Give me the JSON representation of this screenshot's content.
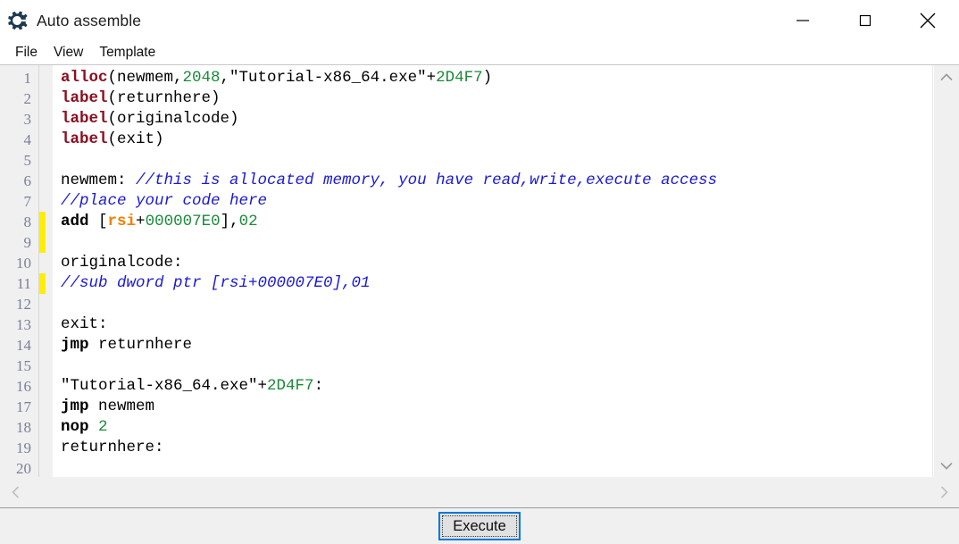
{
  "window": {
    "title": "Auto assemble",
    "icon": "cheat-engine-gear-icon",
    "controls": {
      "minimize": "minimize-icon",
      "maximize": "maximize-icon",
      "close": "close-icon"
    }
  },
  "menubar": {
    "items": [
      {
        "label": "File"
      },
      {
        "label": "View"
      },
      {
        "label": "Template"
      }
    ]
  },
  "editor": {
    "line_numbers": [
      "1",
      "2",
      "3",
      "4",
      "5",
      "6",
      "7",
      "8",
      "9",
      "10",
      "11",
      "12",
      "13",
      "14",
      "15",
      "16",
      "17",
      "18",
      "19",
      "20"
    ],
    "modified_markers": [
      8,
      9,
      11
    ],
    "lines": [
      {
        "n": "1",
        "tokens": [
          {
            "t": "alloc",
            "c": "tok-key"
          },
          {
            "t": "(newmem,",
            "c": "tok-plain"
          },
          {
            "t": "2048",
            "c": "tok-num"
          },
          {
            "t": ",\"Tutorial-x86_64.exe\"+",
            "c": "tok-str"
          },
          {
            "t": "2D4F7",
            "c": "tok-hex"
          },
          {
            "t": ")",
            "c": "tok-plain"
          }
        ]
      },
      {
        "n": "2",
        "tokens": [
          {
            "t": "label",
            "c": "tok-key"
          },
          {
            "t": "(returnhere)",
            "c": "tok-plain"
          }
        ]
      },
      {
        "n": "3",
        "tokens": [
          {
            "t": "label",
            "c": "tok-key"
          },
          {
            "t": "(originalcode)",
            "c": "tok-plain"
          }
        ]
      },
      {
        "n": "4",
        "tokens": [
          {
            "t": "label",
            "c": "tok-key"
          },
          {
            "t": "(exit)",
            "c": "tok-plain"
          }
        ]
      },
      {
        "n": "5",
        "tokens": []
      },
      {
        "n": "6",
        "tokens": [
          {
            "t": "newmem: ",
            "c": "tok-plain"
          },
          {
            "t": "//this is allocated memory, you have read,write,execute access",
            "c": "tok-comment"
          }
        ]
      },
      {
        "n": "7",
        "tokens": [
          {
            "t": "//place your code here",
            "c": "tok-comment"
          }
        ]
      },
      {
        "n": "8",
        "tokens": [
          {
            "t": "add",
            "c": "tok-mnem"
          },
          {
            "t": " [",
            "c": "tok-plain"
          },
          {
            "t": "rsi",
            "c": "tok-reg"
          },
          {
            "t": "+",
            "c": "tok-plain"
          },
          {
            "t": "000007E0",
            "c": "tok-hex"
          },
          {
            "t": "],",
            "c": "tok-plain"
          },
          {
            "t": "02",
            "c": "tok-num"
          }
        ]
      },
      {
        "n": "9",
        "tokens": []
      },
      {
        "n": "10",
        "tokens": [
          {
            "t": "originalcode:",
            "c": "tok-plain"
          }
        ]
      },
      {
        "n": "11",
        "tokens": [
          {
            "t": "//sub dword ptr [rsi+000007E0],01",
            "c": "tok-comment"
          }
        ]
      },
      {
        "n": "12",
        "tokens": []
      },
      {
        "n": "13",
        "tokens": [
          {
            "t": "exit:",
            "c": "tok-plain"
          }
        ]
      },
      {
        "n": "14",
        "tokens": [
          {
            "t": "jmp",
            "c": "tok-mnem"
          },
          {
            "t": " returnhere",
            "c": "tok-plain"
          }
        ]
      },
      {
        "n": "15",
        "tokens": []
      },
      {
        "n": "16",
        "tokens": [
          {
            "t": "\"Tutorial-x86_64.exe\"+",
            "c": "tok-str"
          },
          {
            "t": "2D4F7",
            "c": "tok-hex"
          },
          {
            "t": ":",
            "c": "tok-plain"
          }
        ]
      },
      {
        "n": "17",
        "tokens": [
          {
            "t": "jmp",
            "c": "tok-mnem"
          },
          {
            "t": " newmem",
            "c": "tok-plain"
          }
        ]
      },
      {
        "n": "18",
        "tokens": [
          {
            "t": "nop",
            "c": "tok-mnem"
          },
          {
            "t": " ",
            "c": "tok-plain"
          },
          {
            "t": "2",
            "c": "tok-num"
          }
        ]
      },
      {
        "n": "19",
        "tokens": [
          {
            "t": "returnhere:",
            "c": "tok-plain"
          }
        ]
      },
      {
        "n": "20",
        "tokens": []
      }
    ],
    "plain_text": [
      "alloc(newmem,2048,\"Tutorial-x86_64.exe\"+2D4F7)",
      "label(returnhere)",
      "label(originalcode)",
      "label(exit)",
      "",
      "newmem: //this is allocated memory, you have read,write,execute access",
      "//place your code here",
      "add [rsi+000007E0],02",
      "",
      "originalcode:",
      "//sub dword ptr [rsi+000007E0],01",
      "",
      "exit:",
      "jmp returnhere",
      "",
      "\"Tutorial-x86_64.exe\"+2D4F7:",
      "jmp newmem",
      "nop 2",
      "returnhere:",
      ""
    ]
  },
  "scrollbars": {
    "vertical": {
      "up": "chevron-up-icon",
      "down": "chevron-down-icon"
    },
    "horizontal": {
      "left": "chevron-left-icon",
      "right": "chevron-right-icon"
    }
  },
  "footer": {
    "execute_label": "Execute"
  },
  "colors": {
    "keyword": "#8b0f20",
    "number": "#1a8a3a",
    "register": "#f08000",
    "comment": "#1b19d8",
    "plain": "#000000",
    "gutter_bg": "#f0f0f0",
    "line_number": "#7a7f99",
    "marker": "#ffee00",
    "button_border": "#0078d7",
    "button_face": "#e1e1e1",
    "panel_bg": "#f0f0f0",
    "editor_bg": "#ffffff"
  }
}
